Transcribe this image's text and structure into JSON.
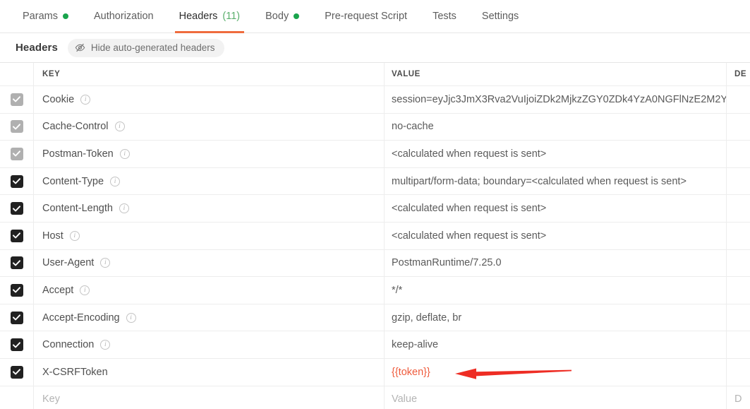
{
  "tabs": [
    {
      "label": "Params",
      "dot": true,
      "count": "",
      "active": false
    },
    {
      "label": "Authorization",
      "dot": false,
      "count": "",
      "active": false
    },
    {
      "label": "Headers",
      "dot": false,
      "count": "(11)",
      "active": true
    },
    {
      "label": "Body",
      "dot": true,
      "count": "",
      "active": false
    },
    {
      "label": "Pre-request Script",
      "dot": false,
      "count": "",
      "active": false
    },
    {
      "label": "Tests",
      "dot": false,
      "count": "",
      "active": false
    },
    {
      "label": "Settings",
      "dot": false,
      "count": "",
      "active": false
    }
  ],
  "subbar": {
    "title": "Headers",
    "toggle_label": "Hide auto-generated headers",
    "toggle_icon": "eye-slash-icon"
  },
  "table": {
    "columns": {
      "key": "KEY",
      "value": "VALUE",
      "description": "DE"
    },
    "rows": [
      {
        "checked": true,
        "auto": true,
        "info": true,
        "key": "Cookie",
        "value": "session=eyJjc3JmX3Rva2VuIjoiZDk2MjkzZGY0ZDk4YzA0NGFlNzE2M2Y",
        "variable": false
      },
      {
        "checked": true,
        "auto": true,
        "info": true,
        "key": "Cache-Control",
        "value": "no-cache",
        "variable": false
      },
      {
        "checked": true,
        "auto": true,
        "info": true,
        "key": "Postman-Token",
        "value": "<calculated when request is sent>",
        "variable": false
      },
      {
        "checked": true,
        "auto": false,
        "info": true,
        "key": "Content-Type",
        "value": "multipart/form-data; boundary=<calculated when request is sent>",
        "variable": false
      },
      {
        "checked": true,
        "auto": false,
        "info": true,
        "key": "Content-Length",
        "value": "<calculated when request is sent>",
        "variable": false
      },
      {
        "checked": true,
        "auto": false,
        "info": true,
        "key": "Host",
        "value": "<calculated when request is sent>",
        "variable": false
      },
      {
        "checked": true,
        "auto": false,
        "info": true,
        "key": "User-Agent",
        "value": "PostmanRuntime/7.25.0",
        "variable": false
      },
      {
        "checked": true,
        "auto": false,
        "info": true,
        "key": "Accept",
        "value": "*/*",
        "variable": false
      },
      {
        "checked": true,
        "auto": false,
        "info": true,
        "key": "Accept-Encoding",
        "value": "gzip, deflate, br",
        "variable": false
      },
      {
        "checked": true,
        "auto": false,
        "info": true,
        "key": "Connection",
        "value": "keep-alive",
        "variable": false
      },
      {
        "checked": true,
        "auto": false,
        "info": false,
        "key": "X-CSRFToken",
        "value": "{{token}}",
        "variable": true
      }
    ],
    "new_row": {
      "key_placeholder": "Key",
      "value_placeholder": "Value",
      "desc_placeholder": "D"
    }
  },
  "annotation": {
    "arrow": "red-left-arrow",
    "color": "#ee2d24"
  },
  "colors": {
    "accent": "#ef6c3e",
    "dot_green": "#19a44c",
    "count_green": "#5aaf6c",
    "variable_red": "#ef5b3c",
    "checkbox_on": "#212121",
    "checkbox_auto": "#b0b0b0"
  }
}
